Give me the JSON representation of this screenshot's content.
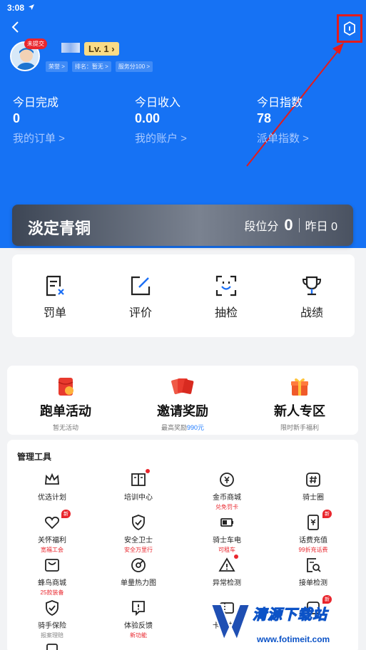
{
  "status": {
    "time": "3:08"
  },
  "profile": {
    "badge": "未提交",
    "level": "Lv. 1",
    "tags": [
      "荣誉 >",
      "排名：暂无 >",
      "服务分100 >"
    ]
  },
  "stats": [
    {
      "label": "今日完成",
      "value": "0",
      "link": "我的订单 >"
    },
    {
      "label": "今日收入",
      "value": "0.00",
      "link": "我的账户 >"
    },
    {
      "label": "今日指数",
      "value": "78",
      "link": "派单指数 >"
    }
  ],
  "rank": {
    "name": "淡定青铜",
    "score_label": "段位分",
    "score": "0",
    "yesterday": "昨日 0"
  },
  "quick": [
    {
      "label": "罚单",
      "icon": "ticket-x-icon"
    },
    {
      "label": "评价",
      "icon": "edit-icon"
    },
    {
      "label": "抽检",
      "icon": "face-scan-icon"
    },
    {
      "label": "战绩",
      "icon": "trophy-icon"
    }
  ],
  "promo": [
    {
      "title": "跑单活动",
      "sub": "暂无活动",
      "icon": "red-envelope-icon"
    },
    {
      "title": "邀请奖励",
      "sub_prefix": "最高奖励",
      "sub_highlight": "990元",
      "icon": "red-packets-icon"
    },
    {
      "title": "新人专区",
      "sub": "限时新手福利",
      "icon": "gift-box-icon"
    }
  ],
  "tools": {
    "title": "管理工具",
    "items": [
      {
        "label": "优选计划",
        "icon": "crown-icon"
      },
      {
        "label": "培训中心",
        "icon": "book-icon",
        "dot": true
      },
      {
        "label": "金币商城",
        "sub": "兑免罚卡",
        "icon": "coin-icon"
      },
      {
        "label": "骑士圈",
        "icon": "hashtag-icon"
      },
      {
        "label": "关怀福利",
        "sub": "宽福工会",
        "icon": "heart-icon",
        "new": "新"
      },
      {
        "label": "安全卫士",
        "sub": "安全万里行",
        "icon": "shield-icon"
      },
      {
        "label": "骑士车电",
        "sub": "可租车",
        "icon": "battery-icon"
      },
      {
        "label": "话费充值",
        "sub": "99折充话费",
        "icon": "phone-recharge-icon",
        "new": "新"
      },
      {
        "label": "蜂鸟商城",
        "sub": "25款装备",
        "icon": "shop-icon"
      },
      {
        "label": "单量热力图",
        "icon": "heatmap-icon"
      },
      {
        "label": "异常检测",
        "icon": "warning-icon",
        "dot": true
      },
      {
        "label": "接单检测",
        "icon": "search-doc-icon"
      },
      {
        "label": "骑手保险",
        "sub": "报案理赔",
        "sub_gray": true,
        "icon": "insurance-icon"
      },
      {
        "label": "体验反馈",
        "sub": "新功能",
        "icon": "feedback-icon"
      },
      {
        "label": "卡券中心",
        "icon": "coupon-icon"
      },
      {
        "label": "",
        "icon": "more-icon",
        "new": "新"
      }
    ]
  },
  "watermark": {
    "text": "清源下载站",
    "url": "www.fotimeit.com"
  }
}
